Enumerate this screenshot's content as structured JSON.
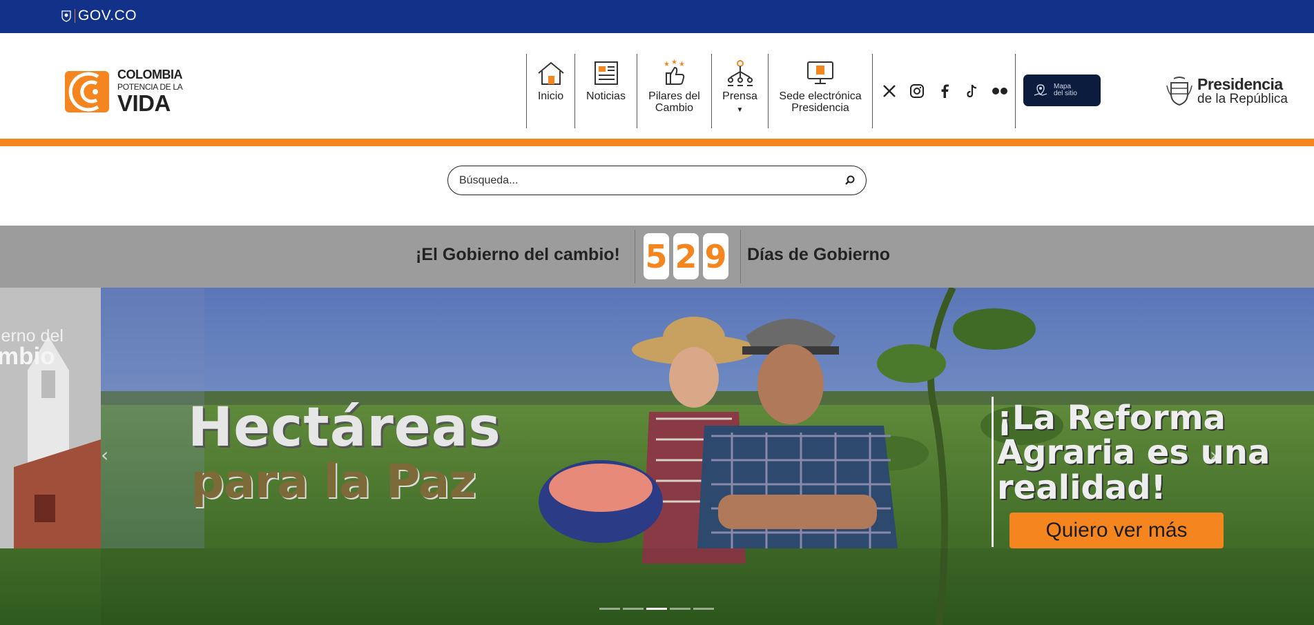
{
  "govbar": {
    "brand": "GOV.CO"
  },
  "brand": {
    "line1": "COLOMBIA",
    "line2": "POTENCIA DE LA",
    "line3": "VIDA",
    "accent": "#f5851f"
  },
  "nav": {
    "items": [
      {
        "label": "Inicio",
        "icon": "house-icon"
      },
      {
        "label": "Noticias",
        "icon": "newspaper-icon"
      },
      {
        "label_line1": "Pilares del",
        "label_line2": "Cambio",
        "icon": "thumbs-up-stars-icon"
      },
      {
        "label": "Prensa",
        "icon": "people-network-icon"
      },
      {
        "label_line1": "Sede electrónica",
        "label_line2": "Presidencia",
        "icon": "monitor-icon"
      }
    ]
  },
  "social": [
    "x-icon",
    "instagram-icon",
    "facebook-icon",
    "tiktok-icon",
    "flickr-icon"
  ],
  "mapa": {
    "line1": "Mapa",
    "line2": "del sitio"
  },
  "presidencia": {
    "line1": "Presidencia",
    "line2": "de la República"
  },
  "search": {
    "placeholder": "Búsqueda..."
  },
  "counter": {
    "slogan": "¡El Gobierno del cambio!",
    "digits": [
      "5",
      "2",
      "9"
    ],
    "suffix": "Días de Gobierno"
  },
  "hero": {
    "prev_line1": "ierno del",
    "prev_line2": "mbio",
    "title1": "Hectáreas",
    "title2": "para la Paz",
    "right_line1": "¡La Reforma",
    "right_line2": "Agraria es una",
    "right_line3": "realidad!",
    "cta": "Quiero ver más",
    "dots": 5,
    "active_dot": 2
  },
  "colors": {
    "govbar": "#123289",
    "orange": "#f5851f",
    "band": "#9c9c9c",
    "mapa": "#0c1c3e"
  }
}
